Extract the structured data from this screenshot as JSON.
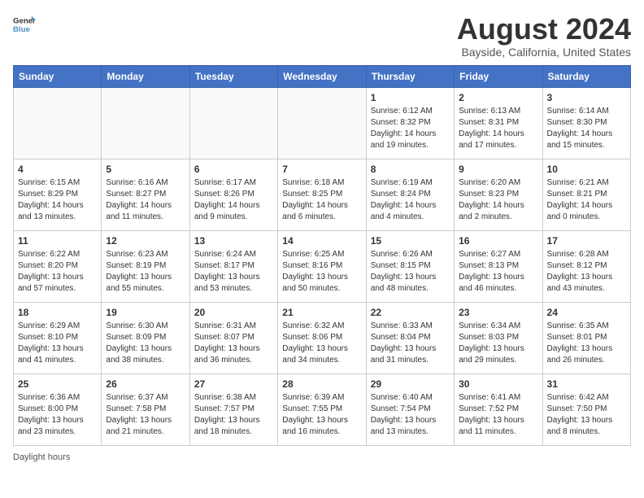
{
  "logo": {
    "line1": "General",
    "line2": "Blue"
  },
  "title": "August 2024",
  "location": "Bayside, California, United States",
  "days_of_week": [
    "Sunday",
    "Monday",
    "Tuesday",
    "Wednesday",
    "Thursday",
    "Friday",
    "Saturday"
  ],
  "weeks": [
    [
      {
        "day": "",
        "info": ""
      },
      {
        "day": "",
        "info": ""
      },
      {
        "day": "",
        "info": ""
      },
      {
        "day": "",
        "info": ""
      },
      {
        "day": "1",
        "info": "Sunrise: 6:12 AM\nSunset: 8:32 PM\nDaylight: 14 hours\nand 19 minutes."
      },
      {
        "day": "2",
        "info": "Sunrise: 6:13 AM\nSunset: 8:31 PM\nDaylight: 14 hours\nand 17 minutes."
      },
      {
        "day": "3",
        "info": "Sunrise: 6:14 AM\nSunset: 8:30 PM\nDaylight: 14 hours\nand 15 minutes."
      }
    ],
    [
      {
        "day": "4",
        "info": "Sunrise: 6:15 AM\nSunset: 8:29 PM\nDaylight: 14 hours\nand 13 minutes."
      },
      {
        "day": "5",
        "info": "Sunrise: 6:16 AM\nSunset: 8:27 PM\nDaylight: 14 hours\nand 11 minutes."
      },
      {
        "day": "6",
        "info": "Sunrise: 6:17 AM\nSunset: 8:26 PM\nDaylight: 14 hours\nand 9 minutes."
      },
      {
        "day": "7",
        "info": "Sunrise: 6:18 AM\nSunset: 8:25 PM\nDaylight: 14 hours\nand 6 minutes."
      },
      {
        "day": "8",
        "info": "Sunrise: 6:19 AM\nSunset: 8:24 PM\nDaylight: 14 hours\nand 4 minutes."
      },
      {
        "day": "9",
        "info": "Sunrise: 6:20 AM\nSunset: 8:23 PM\nDaylight: 14 hours\nand 2 minutes."
      },
      {
        "day": "10",
        "info": "Sunrise: 6:21 AM\nSunset: 8:21 PM\nDaylight: 14 hours\nand 0 minutes."
      }
    ],
    [
      {
        "day": "11",
        "info": "Sunrise: 6:22 AM\nSunset: 8:20 PM\nDaylight: 13 hours\nand 57 minutes."
      },
      {
        "day": "12",
        "info": "Sunrise: 6:23 AM\nSunset: 8:19 PM\nDaylight: 13 hours\nand 55 minutes."
      },
      {
        "day": "13",
        "info": "Sunrise: 6:24 AM\nSunset: 8:17 PM\nDaylight: 13 hours\nand 53 minutes."
      },
      {
        "day": "14",
        "info": "Sunrise: 6:25 AM\nSunset: 8:16 PM\nDaylight: 13 hours\nand 50 minutes."
      },
      {
        "day": "15",
        "info": "Sunrise: 6:26 AM\nSunset: 8:15 PM\nDaylight: 13 hours\nand 48 minutes."
      },
      {
        "day": "16",
        "info": "Sunrise: 6:27 AM\nSunset: 8:13 PM\nDaylight: 13 hours\nand 46 minutes."
      },
      {
        "day": "17",
        "info": "Sunrise: 6:28 AM\nSunset: 8:12 PM\nDaylight: 13 hours\nand 43 minutes."
      }
    ],
    [
      {
        "day": "18",
        "info": "Sunrise: 6:29 AM\nSunset: 8:10 PM\nDaylight: 13 hours\nand 41 minutes."
      },
      {
        "day": "19",
        "info": "Sunrise: 6:30 AM\nSunset: 8:09 PM\nDaylight: 13 hours\nand 38 minutes."
      },
      {
        "day": "20",
        "info": "Sunrise: 6:31 AM\nSunset: 8:07 PM\nDaylight: 13 hours\nand 36 minutes."
      },
      {
        "day": "21",
        "info": "Sunrise: 6:32 AM\nSunset: 8:06 PM\nDaylight: 13 hours\nand 34 minutes."
      },
      {
        "day": "22",
        "info": "Sunrise: 6:33 AM\nSunset: 8:04 PM\nDaylight: 13 hours\nand 31 minutes."
      },
      {
        "day": "23",
        "info": "Sunrise: 6:34 AM\nSunset: 8:03 PM\nDaylight: 13 hours\nand 29 minutes."
      },
      {
        "day": "24",
        "info": "Sunrise: 6:35 AM\nSunset: 8:01 PM\nDaylight: 13 hours\nand 26 minutes."
      }
    ],
    [
      {
        "day": "25",
        "info": "Sunrise: 6:36 AM\nSunset: 8:00 PM\nDaylight: 13 hours\nand 23 minutes."
      },
      {
        "day": "26",
        "info": "Sunrise: 6:37 AM\nSunset: 7:58 PM\nDaylight: 13 hours\nand 21 minutes."
      },
      {
        "day": "27",
        "info": "Sunrise: 6:38 AM\nSunset: 7:57 PM\nDaylight: 13 hours\nand 18 minutes."
      },
      {
        "day": "28",
        "info": "Sunrise: 6:39 AM\nSunset: 7:55 PM\nDaylight: 13 hours\nand 16 minutes."
      },
      {
        "day": "29",
        "info": "Sunrise: 6:40 AM\nSunset: 7:54 PM\nDaylight: 13 hours\nand 13 minutes."
      },
      {
        "day": "30",
        "info": "Sunrise: 6:41 AM\nSunset: 7:52 PM\nDaylight: 13 hours\nand 11 minutes."
      },
      {
        "day": "31",
        "info": "Sunrise: 6:42 AM\nSunset: 7:50 PM\nDaylight: 13 hours\nand 8 minutes."
      }
    ]
  ],
  "legend": "Daylight hours"
}
